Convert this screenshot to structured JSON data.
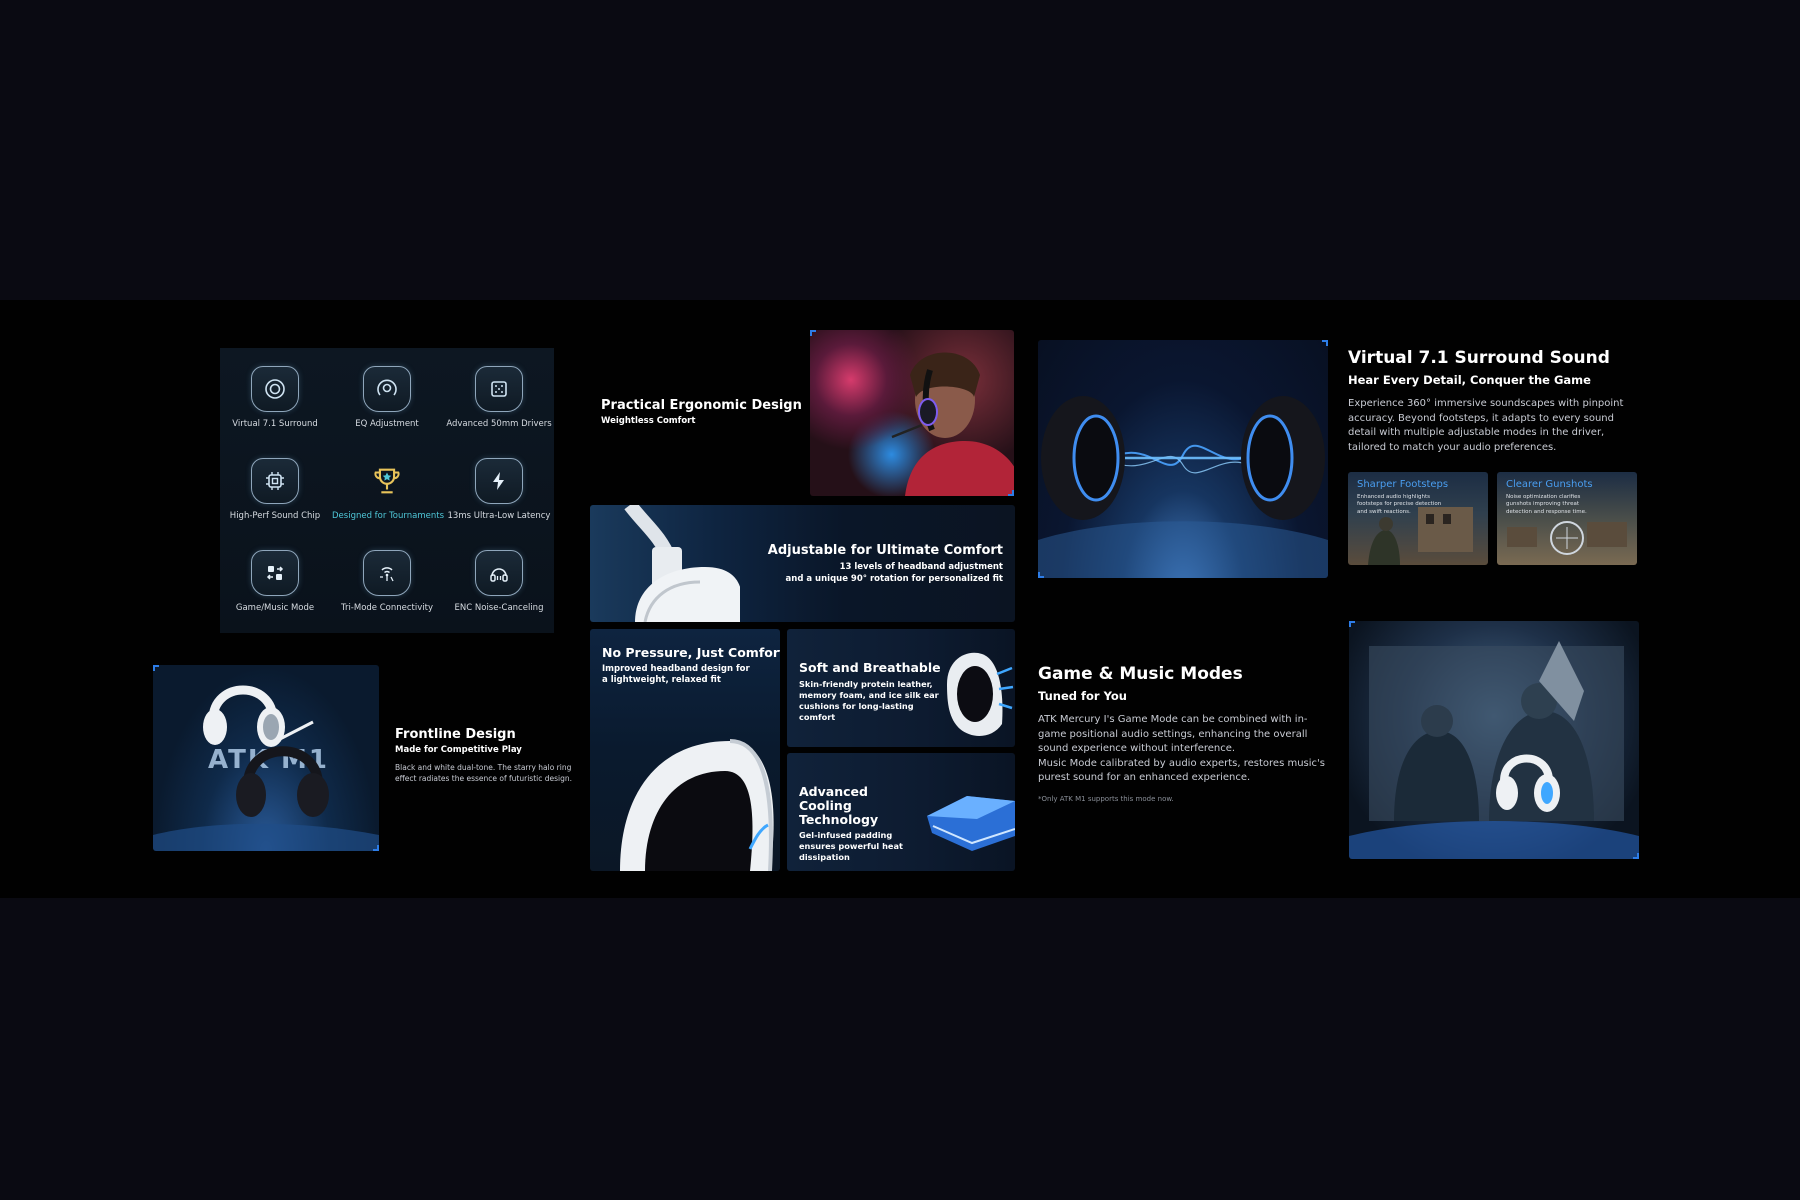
{
  "features": [
    {
      "label": "Virtual 7.1 Surround",
      "icon": "surround-icon",
      "highlight": false
    },
    {
      "label": "EQ Adjustment",
      "icon": "eq-icon",
      "highlight": false
    },
    {
      "label": "Advanced 50mm Drivers",
      "icon": "driver-icon",
      "highlight": false
    },
    {
      "label": "High-Perf Sound Chip",
      "icon": "chip-icon",
      "highlight": false
    },
    {
      "label": "Designed for Tournaments",
      "icon": "trophy-icon",
      "highlight": true
    },
    {
      "label": "13ms Ultra-Low Latency",
      "icon": "lightning-icon",
      "highlight": false
    },
    {
      "label": "Game/Music Mode",
      "icon": "mode-switch-icon",
      "highlight": false
    },
    {
      "label": "Tri-Mode Connectivity",
      "icon": "wireless-icon",
      "highlight": false
    },
    {
      "label": "ENC Noise-Canceling",
      "icon": "headphone-icon",
      "highlight": false
    }
  ],
  "ergonomic": {
    "title": "Practical Ergonomic Design",
    "subtitle": "Weightless Comfort"
  },
  "adjustable": {
    "title": "Adjustable for Ultimate Comfort",
    "line1": "13 levels of headband adjustment",
    "line2": "and a unique 90° rotation for personalized fit"
  },
  "frontline": {
    "title": "Frontline Design",
    "subtitle": "Made for Competitive Play",
    "text": "Black and white dual-tone. The starry halo ring effect radiates the essence of futuristic design.",
    "logo": "ATK M1"
  },
  "no_pressure": {
    "title": "No Pressure, Just Comfort",
    "text": "Improved headband design for a lightweight, relaxed fit"
  },
  "soft": {
    "title": "Soft and Breathable",
    "text": "Skin-friendly protein leather, memory foam, and ice silk ear cushions for long-lasting comfort"
  },
  "cooling": {
    "title": "Advanced Cooling Technology",
    "text": "Gel-infused padding ensures powerful heat dissipation"
  },
  "surround": {
    "title": "Virtual 7.1 Surround Sound",
    "subtitle": "Hear Every Detail, Conquer the Game",
    "text": "Experience 360° immersive soundscapes with pinpoint accuracy. Beyond footsteps, it adapts to every sound detail with multiple adjustable modes in the driver, tailored to match your audio preferences.",
    "cards": [
      {
        "title": "Sharper Footsteps",
        "text": "Enhanced audio highlights footsteps for precise detection and swift reactions."
      },
      {
        "title": "Clearer Gunshots",
        "text": "Noise optimization clarifies gunshots improving threat detection and response time."
      }
    ]
  },
  "modes": {
    "title": "Game & Music Modes",
    "subtitle": "Tuned for You",
    "text1": "ATK Mercury I's Game Mode can be combined with in-game positional audio settings, enhancing the overall sound experience without interference.",
    "text2": "Music Mode calibrated by audio experts, restores music's purest sound for an enhanced experience.",
    "note": "*Only ATK M1 supports this mode now."
  },
  "colors": {
    "accent": "#2d7de8",
    "highlight": "#4fc7d8",
    "card_title": "#4a9ef0"
  }
}
